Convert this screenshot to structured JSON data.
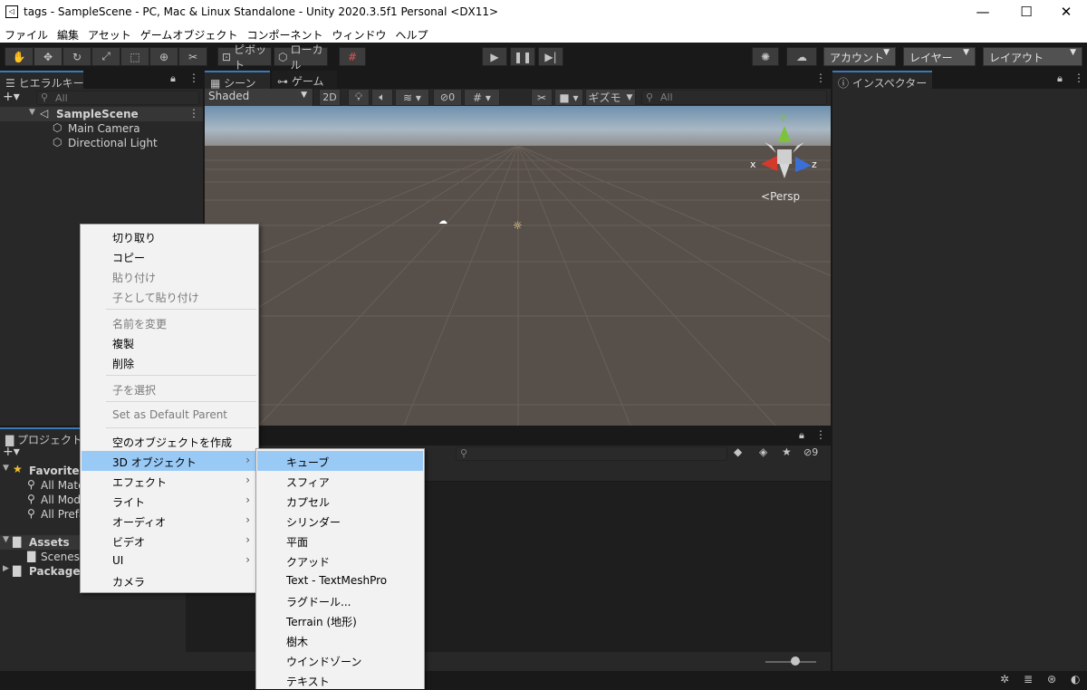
{
  "window": {
    "title": "tags - SampleScene - PC, Mac & Linux Standalone - Unity 2020.3.5f1 Personal <DX11>",
    "minimize": "—",
    "maximize": "☐",
    "close": "✕"
  },
  "menu": [
    "ファイル",
    "編集",
    "アセット",
    "ゲームオブジェクト",
    "コンポーネント",
    "ウィンドウ",
    "ヘルプ"
  ],
  "toolbar": {
    "pivot": "ピボット",
    "local": "ローカル",
    "account": "アカウント",
    "layers": "レイヤー",
    "layout": "レイアウト"
  },
  "hierarchy": {
    "tab": "ヒエラルキー",
    "search_placeholder": "All",
    "scene": "SampleScene",
    "items": [
      "Main Camera",
      "Directional Light"
    ]
  },
  "scene_panel": {
    "tab_scene": "シーン",
    "tab_game": "ゲーム",
    "shading": "Shaded",
    "mode_2d": "2D",
    "hidden_count": "0",
    "gizmos": "ギズモ",
    "search_placeholder": "All",
    "persp": "Persp",
    "axes": {
      "x": "x",
      "y": "y",
      "z": "z"
    }
  },
  "inspector": {
    "tab": "インスペクター"
  },
  "project": {
    "tab": "プロジェクト",
    "hidden_count": "9",
    "favorites": "Favorites",
    "favorite_items": [
      "All Mate",
      "All Mod",
      "All Prefa"
    ],
    "assets": "Assets",
    "asset_items": [
      "Scenes"
    ],
    "packages": "Packages"
  },
  "context_menu": {
    "items": [
      {
        "label": "切り取り",
        "enabled": true
      },
      {
        "label": "コピー",
        "enabled": true
      },
      {
        "label": "貼り付け",
        "enabled": false
      },
      {
        "label": "子として貼り付け",
        "enabled": false
      },
      {
        "label": "名前を変更",
        "enabled": false
      },
      {
        "label": "複製",
        "enabled": true
      },
      {
        "label": "削除",
        "enabled": true
      },
      {
        "label": "子を選択",
        "enabled": false
      },
      {
        "label": "Set as Default Parent",
        "enabled": false
      },
      {
        "label": "空のオブジェクトを作成",
        "enabled": true
      },
      {
        "label": "3D オブジェクト",
        "enabled": true,
        "selected": true,
        "submenu": true
      },
      {
        "label": "エフェクト",
        "enabled": true,
        "submenu": true
      },
      {
        "label": "ライト",
        "enabled": true,
        "submenu": true
      },
      {
        "label": "オーディオ",
        "enabled": true,
        "submenu": true
      },
      {
        "label": "ビデオ",
        "enabled": true,
        "submenu": true
      },
      {
        "label": "UI",
        "enabled": true,
        "submenu": true
      },
      {
        "label": "カメラ",
        "enabled": true
      }
    ]
  },
  "submenu_3d": {
    "items": [
      "キューブ",
      "スフィア",
      "カプセル",
      "シリンダー",
      "平面",
      "クアッド",
      "Text - TextMeshPro",
      "ラグドール...",
      "Terrain (地形)",
      "樹木",
      "ウインドゾーン",
      "テキスト"
    ],
    "selected": "キューブ"
  },
  "colors": {
    "editor_bg": "#282828",
    "toolbar_bg": "#191919",
    "menu_highlight": "#99c9f5",
    "scene_ground": "#574f49",
    "axis_x": "#d33a2c",
    "axis_y": "#7cc23b",
    "axis_z": "#3a6fd8"
  }
}
